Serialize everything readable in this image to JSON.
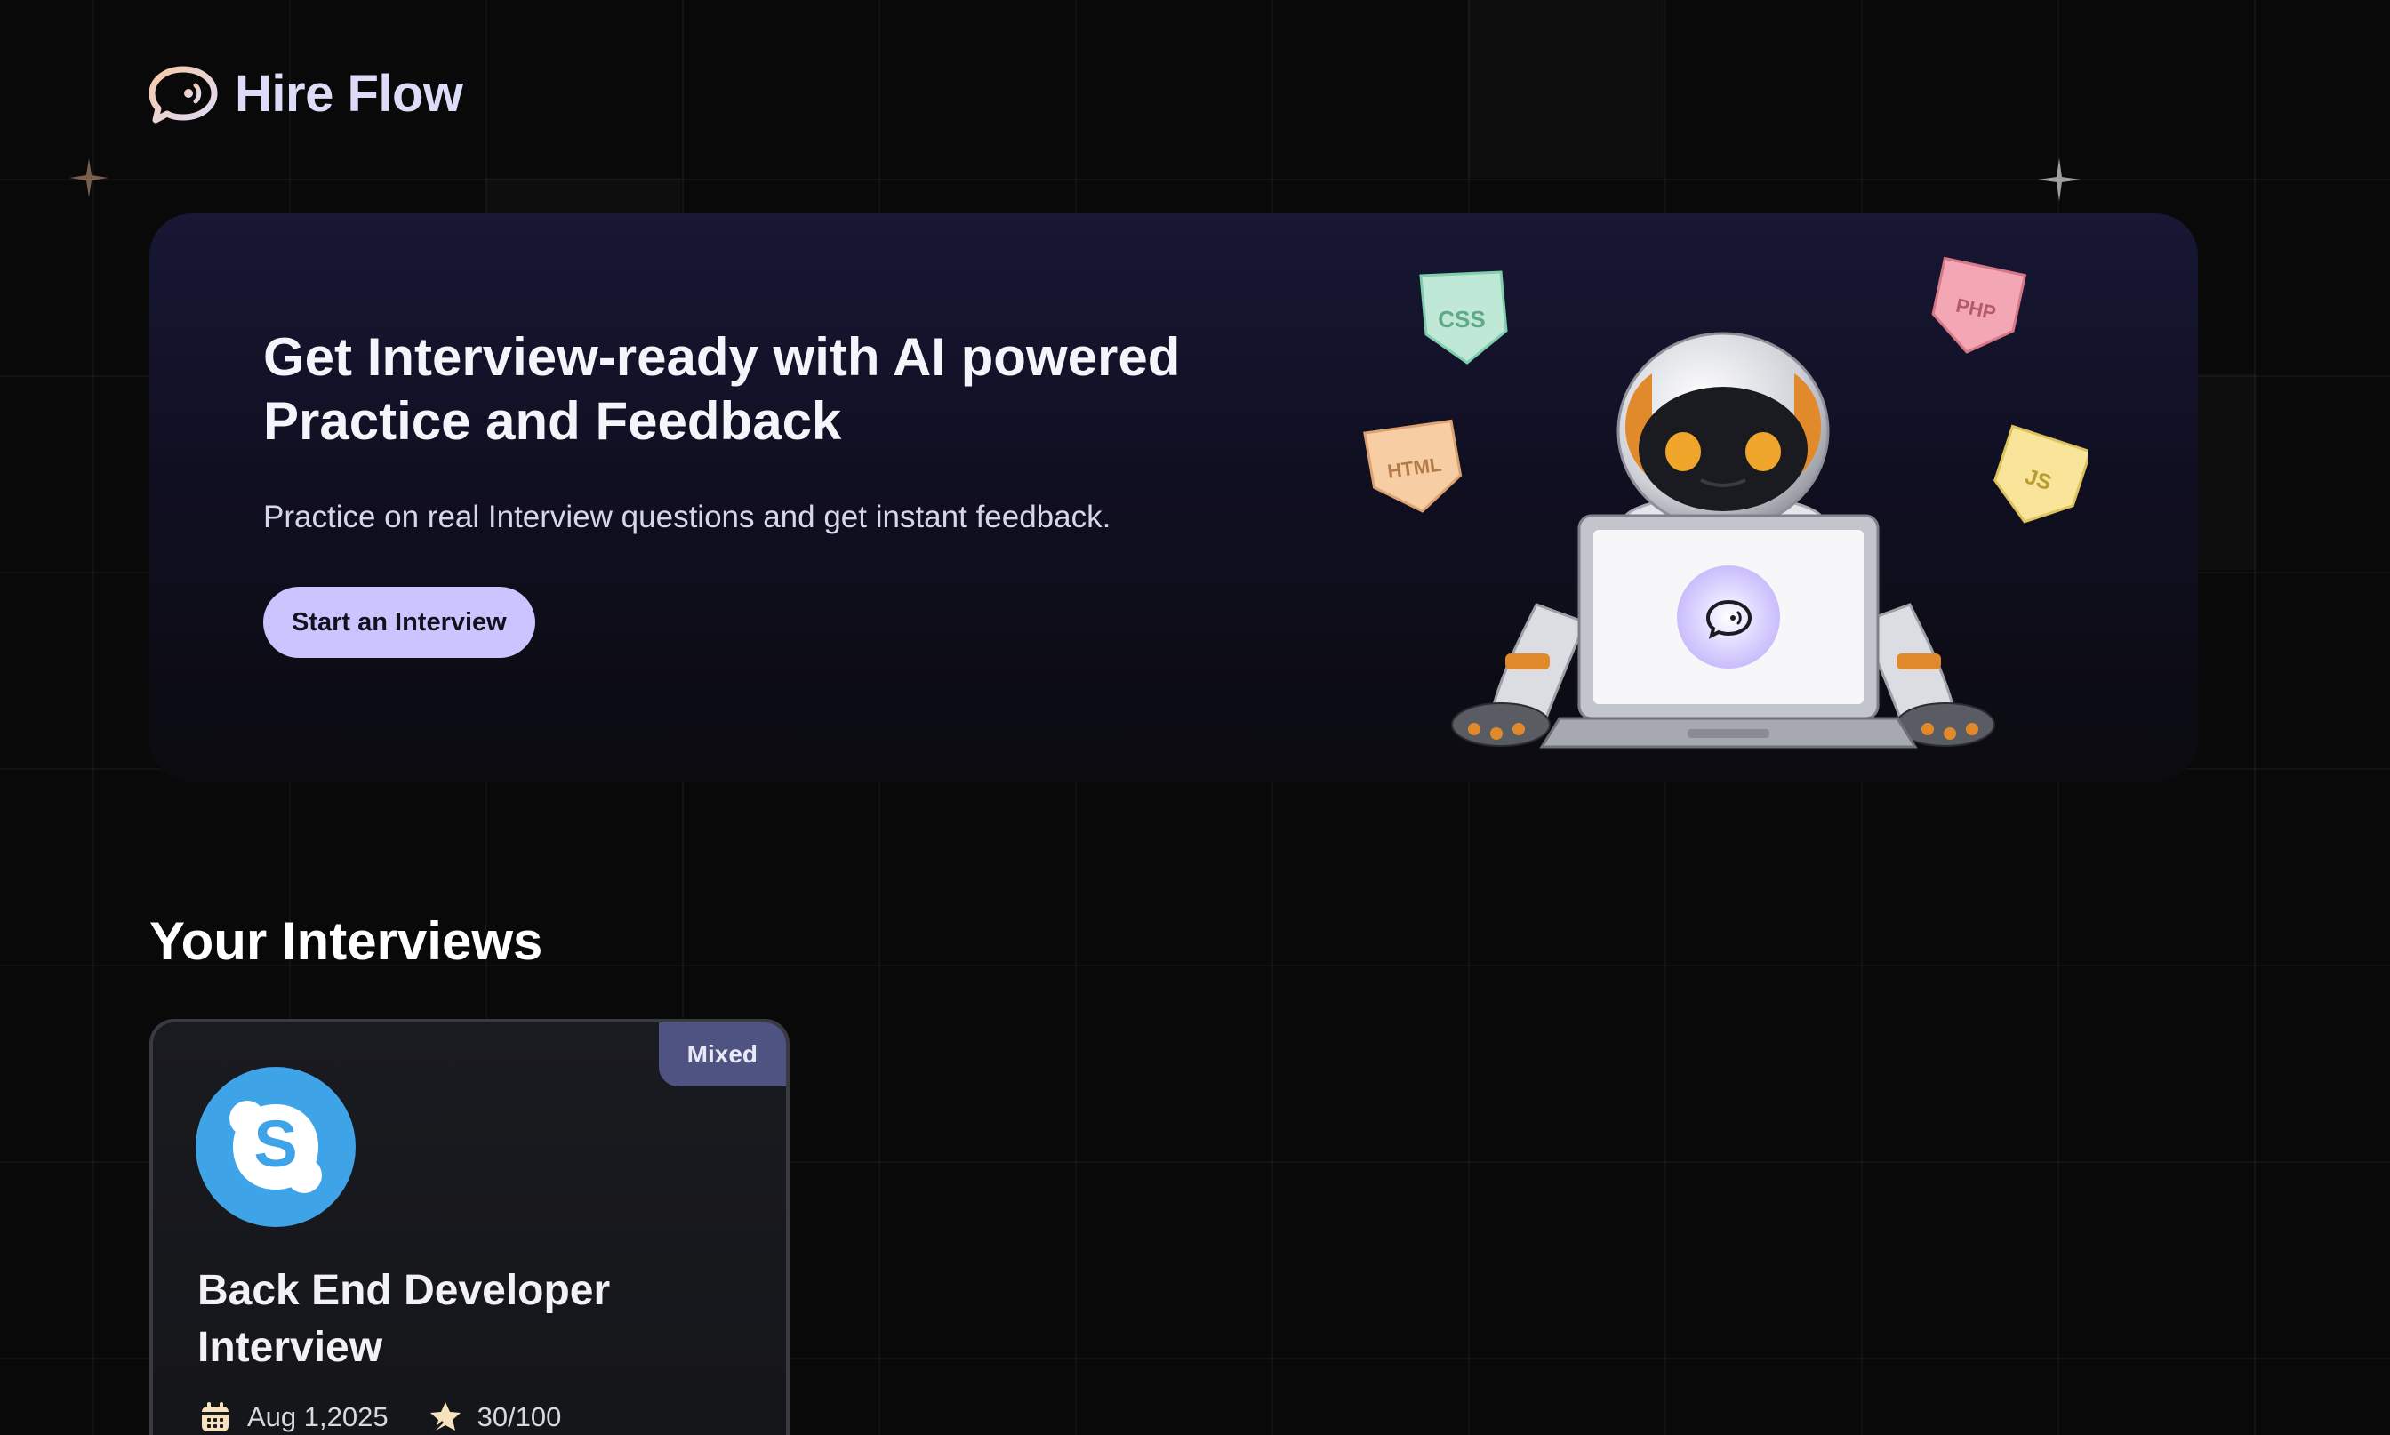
{
  "brand": {
    "name": "Hire Flow",
    "logo_icon": "chat-bubble-sound-icon",
    "gradient_colors": [
      "#f7c9a8",
      "#dcdcf8"
    ]
  },
  "hero": {
    "title": "Get Interview-ready with AI powered Practice and Feedback",
    "subtitle": "Practice on real Interview questions and get instant feedback.",
    "cta_label": "Start an Interview",
    "illustration": "robot-with-laptop",
    "tech_badges": [
      "CSS",
      "PHP",
      "HTML",
      "JS"
    ]
  },
  "section": {
    "title": "Your Interviews"
  },
  "interviews": [
    {
      "type": "Mixed",
      "company_icon": "skype-icon",
      "title": "Back End Developer Interview",
      "date": "Aug 1,2025",
      "score": "30/100",
      "date_icon": "calendar-icon",
      "score_icon": "star-icon"
    }
  ],
  "colors": {
    "background": "#09090a",
    "accent": "#cac5fe",
    "badge": "#4e5382",
    "skype_blue": "#3fa3e8"
  }
}
